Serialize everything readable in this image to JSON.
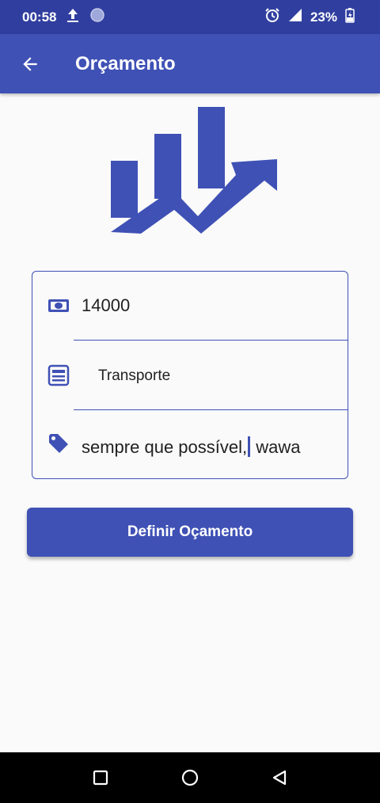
{
  "status_bar": {
    "time": "00:58",
    "battery": "23%",
    "icons": [
      "upload-icon",
      "circle-icon",
      "alarm-icon",
      "signal-icon",
      "battery-charging-icon"
    ]
  },
  "app_bar": {
    "title": "Orçamento",
    "back_icon": "arrow-left-icon"
  },
  "logo": {
    "icon": "growth-chart-logo"
  },
  "form": {
    "amount": {
      "icon": "money-icon",
      "value": "14000"
    },
    "category": {
      "icon": "list-icon",
      "value": "Transporte"
    },
    "note": {
      "icon": "tag-icon",
      "value_before_cursor": "sempre que possível,",
      "value_after_cursor": " wawa"
    }
  },
  "submit_button": {
    "label": "Definir Oçamento"
  },
  "nav_bar": {
    "icons": [
      "recents-icon",
      "home-icon",
      "back-icon"
    ]
  },
  "colors": {
    "primary": "#3f51b5",
    "primary_dark": "#303f9f",
    "background": "#fafafa"
  }
}
